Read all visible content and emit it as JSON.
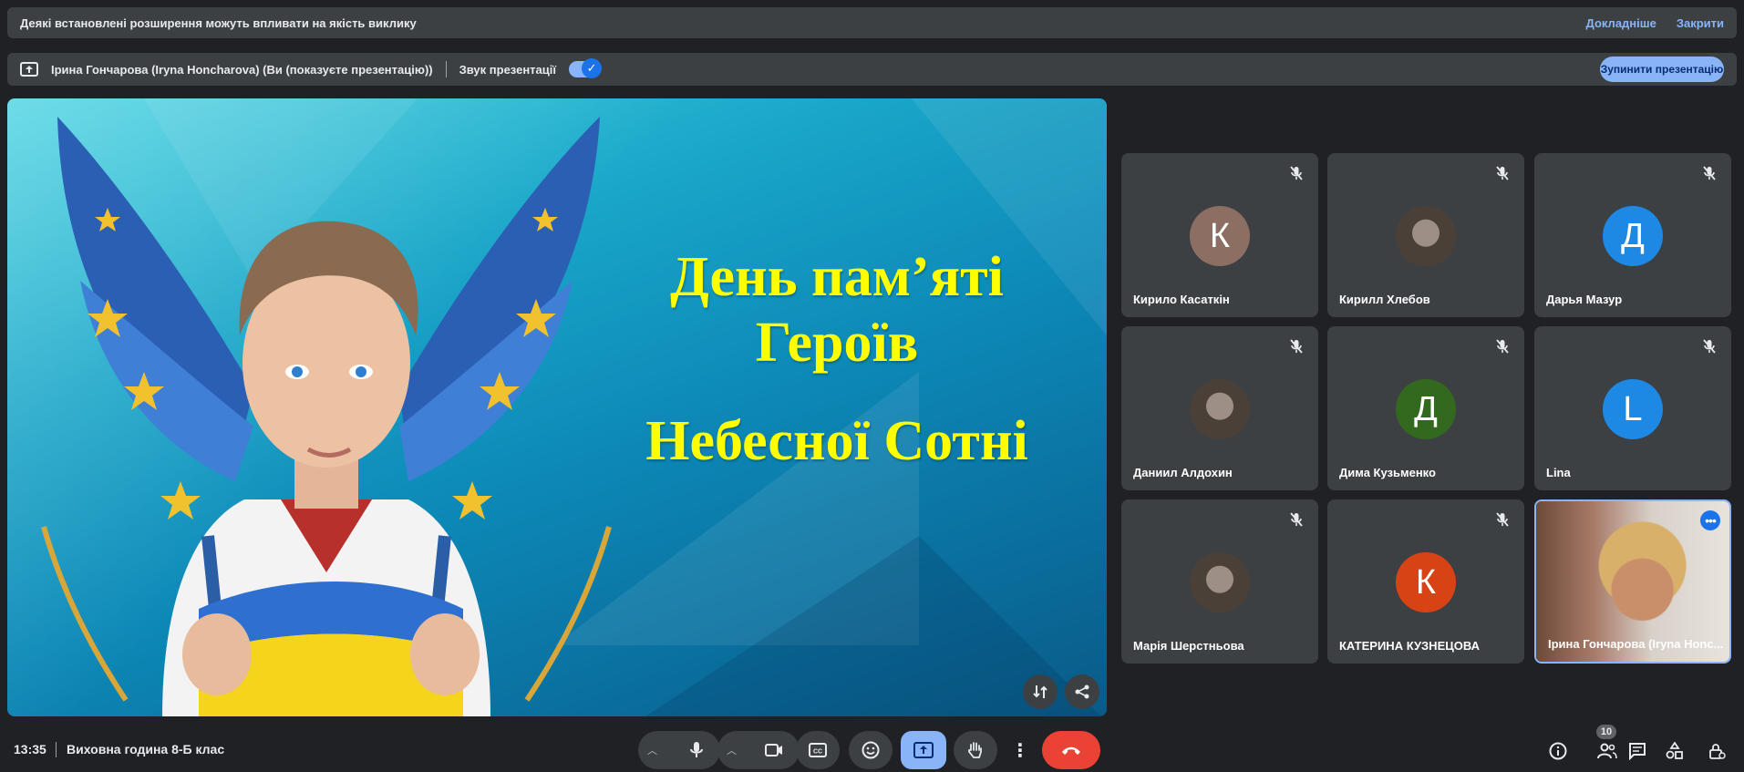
{
  "warning": {
    "message": "Деякі встановлені розширення можуть впливати на якість виклику",
    "details_link": "Докладніше",
    "close_link": "Закрити"
  },
  "presenting": {
    "presenter_text": "Ірина Гончарова (Iryna Honcharova) (Ви (показуєте презентацію))",
    "audio_label": "Звук презентації",
    "audio_enabled": true,
    "stop_button": "Зупинити презентацію"
  },
  "slide": {
    "line1": "День пам’яті",
    "line2": "Героїв",
    "line3": "Небесної Сотні"
  },
  "participants": [
    {
      "name": "Кирило Касаткін",
      "initial": "К",
      "color": "#8d6e63",
      "muted": true
    },
    {
      "name": "Кирилл Хлебов",
      "initial": "",
      "photo": true,
      "muted": true
    },
    {
      "name": "Дарья Мазур",
      "initial": "Д",
      "color": "#1e88e5",
      "muted": true
    },
    {
      "name": "Даниил Алдохин",
      "initial": "",
      "photo": true,
      "muted": true
    },
    {
      "name": "Дима Кузьменко",
      "initial": "Д",
      "color": "#33691e",
      "muted": true
    },
    {
      "name": "Lina",
      "initial": "L",
      "color": "#1e88e5",
      "muted": true
    },
    {
      "name": "Марія Шерстньова",
      "initial": "",
      "photo": true,
      "muted": true
    },
    {
      "name": "КАТЕРИНА КУЗНЕЦОВА",
      "initial": "К",
      "color": "#d84315",
      "muted": true
    },
    {
      "name": "Ірина Гончарова (Iryna Honc...",
      "camera": true,
      "muted": false
    }
  ],
  "bottom": {
    "time": "13:35",
    "meeting_name": "Виховна година 8-Б клас",
    "people_count": "10"
  }
}
